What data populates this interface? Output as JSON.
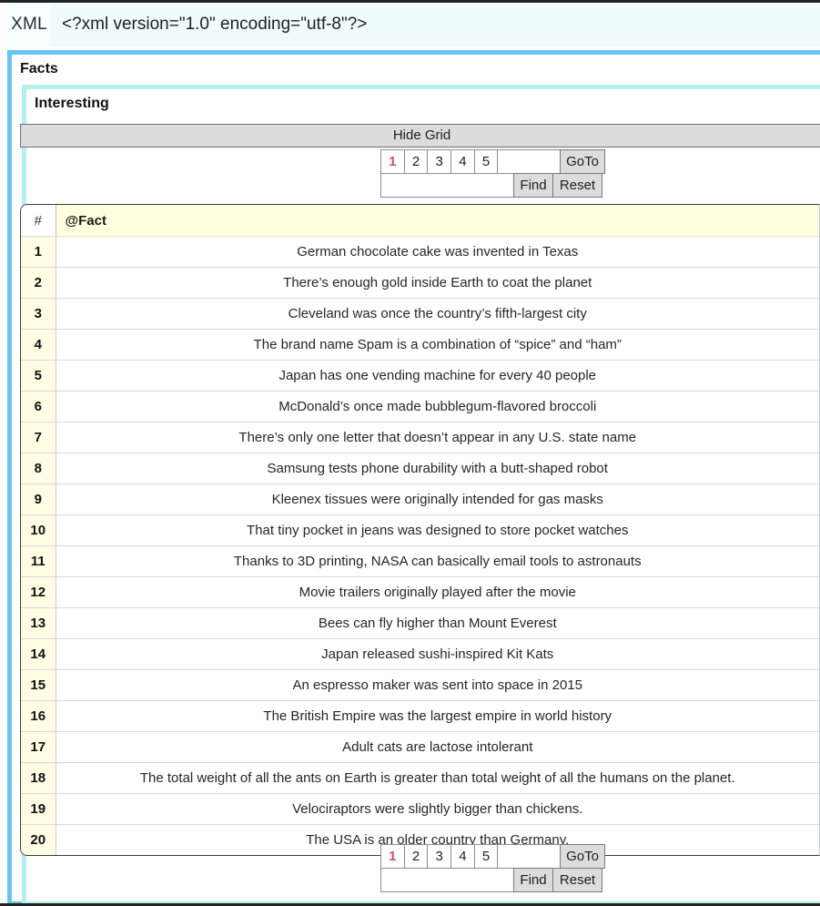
{
  "document": {
    "xml_label": "XML",
    "xml_declaration": "<?xml version=\"1.0\" encoding=\"utf-8\"?>",
    "root_element": "Facts",
    "child_element": "Interesting"
  },
  "toolbar": {
    "hide_grid_label": "Hide Grid"
  },
  "pager": {
    "pages": [
      "1",
      "2",
      "3",
      "4",
      "5"
    ],
    "current_page": "1",
    "goto_label": "GoTo",
    "find_label": "Find",
    "reset_label": "Reset",
    "goto_value": "",
    "find_value": "",
    "goto_placeholder": "",
    "find_placeholder": ""
  },
  "grid": {
    "columns": [
      "#",
      "@Fact"
    ],
    "rows": [
      {
        "n": "1",
        "fact": "German chocolate cake was invented in Texas"
      },
      {
        "n": "2",
        "fact": "There’s enough gold inside Earth to coat the planet"
      },
      {
        "n": "3",
        "fact": "Cleveland was once the country’s fifth-largest city"
      },
      {
        "n": "4",
        "fact": "The brand name Spam is a combination of “spice” and “ham”"
      },
      {
        "n": "5",
        "fact": "Japan has one vending machine for every 40 people"
      },
      {
        "n": "6",
        "fact": "McDonald’s once made bubblegum-flavored broccoli"
      },
      {
        "n": "7",
        "fact": "There’s only one letter that doesn’t appear in any U.S. state name"
      },
      {
        "n": "8",
        "fact": "Samsung tests phone durability with a butt-shaped robot"
      },
      {
        "n": "9",
        "fact": "Kleenex tissues were originally intended for gas masks"
      },
      {
        "n": "10",
        "fact": "That tiny pocket in jeans was designed to store pocket watches"
      },
      {
        "n": "11",
        "fact": "Thanks to 3D printing, NASA can basically email tools to astronauts"
      },
      {
        "n": "12",
        "fact": "Movie trailers originally played after the movie"
      },
      {
        "n": "13",
        "fact": "Bees can fly higher than Mount Everest"
      },
      {
        "n": "14",
        "fact": "Japan released sushi-inspired Kit Kats"
      },
      {
        "n": "15",
        "fact": "An espresso maker was sent into space in 2015"
      },
      {
        "n": "16",
        "fact": "The British Empire was the largest empire in world history"
      },
      {
        "n": "17",
        "fact": "Adult cats are lactose intolerant"
      },
      {
        "n": "18",
        "fact": "The total weight of all the ants on Earth is greater than total weight of all the humans on the planet."
      },
      {
        "n": "19",
        "fact": "Velociraptors were slightly bigger than chickens."
      },
      {
        "n": "20",
        "fact": "The USA is an older country than Germany."
      }
    ]
  },
  "colors": {
    "root_border": "#66c6ef",
    "child_border": "#b3f0f0",
    "xml_bar_bg": "#effbfd",
    "header_fact_bg": "#ffffdf",
    "row_number_bg": "#fffde4",
    "current_page_text": "#d4487c",
    "button_bg": "#dcdcdc"
  }
}
